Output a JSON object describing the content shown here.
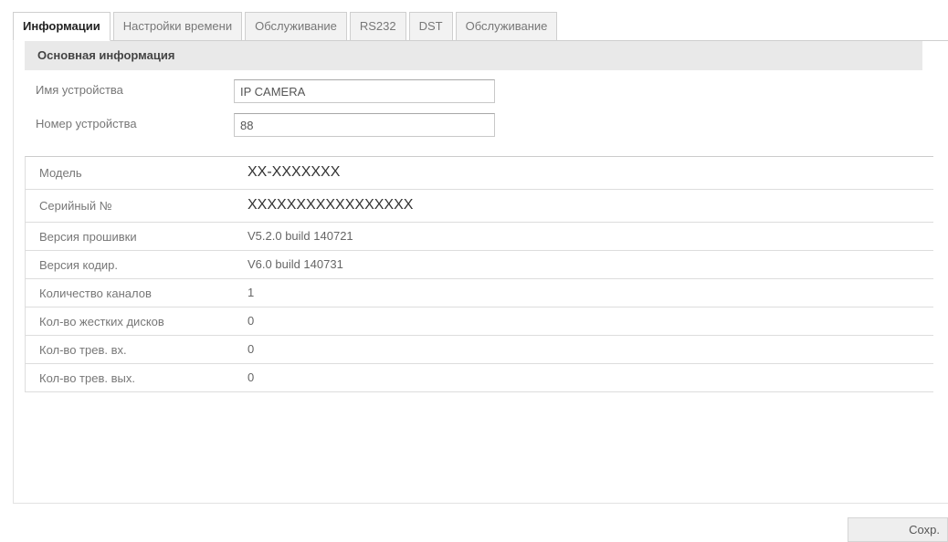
{
  "tabs": [
    {
      "label": "Информации",
      "active": true
    },
    {
      "label": "Настройки времени",
      "active": false
    },
    {
      "label": "Обслуживание",
      "active": false
    },
    {
      "label": "RS232",
      "active": false
    },
    {
      "label": "DST",
      "active": false
    },
    {
      "label": "Обслуживание",
      "active": false
    }
  ],
  "basic_info": {
    "title": "Основная информация",
    "device_name_label": "Имя устройства",
    "device_name_value": "IP CAMERA",
    "device_number_label": "Номер устройства",
    "device_number_value": "88"
  },
  "info_rows": [
    {
      "label": "Модель",
      "value": "XX-XXXXXXX"
    },
    {
      "label": "Серийный №",
      "value": "XXXXXXXXXXXXXXXXX"
    },
    {
      "label": "Версия прошивки",
      "value": "V5.2.0 build 140721"
    },
    {
      "label": "Версия кодир.",
      "value": "V6.0 build 140731"
    },
    {
      "label": "Количество каналов",
      "value": "1"
    },
    {
      "label": "Кол-во жестких дисков",
      "value": "0"
    },
    {
      "label": "Кол-во трев. вх.",
      "value": "0"
    },
    {
      "label": "Кол-во трев. вых.",
      "value": "0"
    }
  ],
  "actions": {
    "save_label": "Сохр."
  }
}
